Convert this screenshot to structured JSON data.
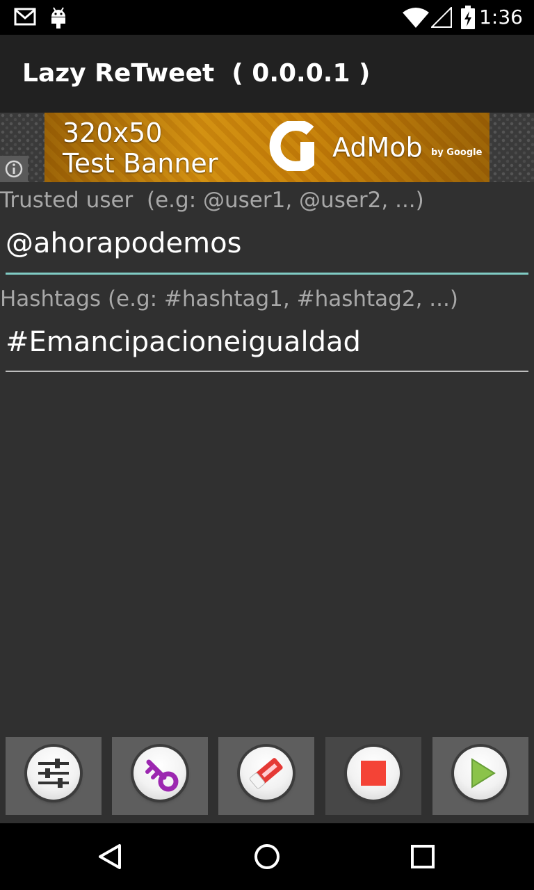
{
  "status_bar": {
    "time": "1:36",
    "icons": [
      "gmail-icon",
      "android-debug-icon",
      "wifi-icon",
      "cell-signal-icon",
      "battery-charging-icon"
    ]
  },
  "app_bar": {
    "title": "Lazy ReTweet  ( 0.0.0.1 )"
  },
  "ad": {
    "line1": "320x50",
    "line2": "Test Banner",
    "brand": "AdMob",
    "by": "by Google"
  },
  "form": {
    "trusted_user": {
      "label": "Trusted user  (e.g: @user1, @user2, ...)",
      "value": "@ahorapodemos",
      "focused": true
    },
    "hashtags": {
      "label": "Hashtags (e.g: #hashtag1, #hashtag2, ...)",
      "value": "#Emancipacioneigualdad",
      "focused": false
    }
  },
  "toolbar": {
    "buttons": [
      {
        "name": "settings",
        "icon": "sliders-icon"
      },
      {
        "name": "key",
        "icon": "key-icon"
      },
      {
        "name": "eraser",
        "icon": "eraser-icon"
      },
      {
        "name": "stop",
        "icon": "stop-icon",
        "state": "disabled"
      },
      {
        "name": "play",
        "icon": "play-icon"
      }
    ]
  },
  "nav_bar": {
    "buttons": [
      "back-icon",
      "home-icon",
      "recents-icon"
    ]
  },
  "colors": {
    "background": "#303030",
    "app_bar": "#212121",
    "focus_underline": "#80cbc4",
    "stop_red": "#f44336",
    "play_green": "#8bc34a",
    "key_purple": "#9c27b0"
  }
}
